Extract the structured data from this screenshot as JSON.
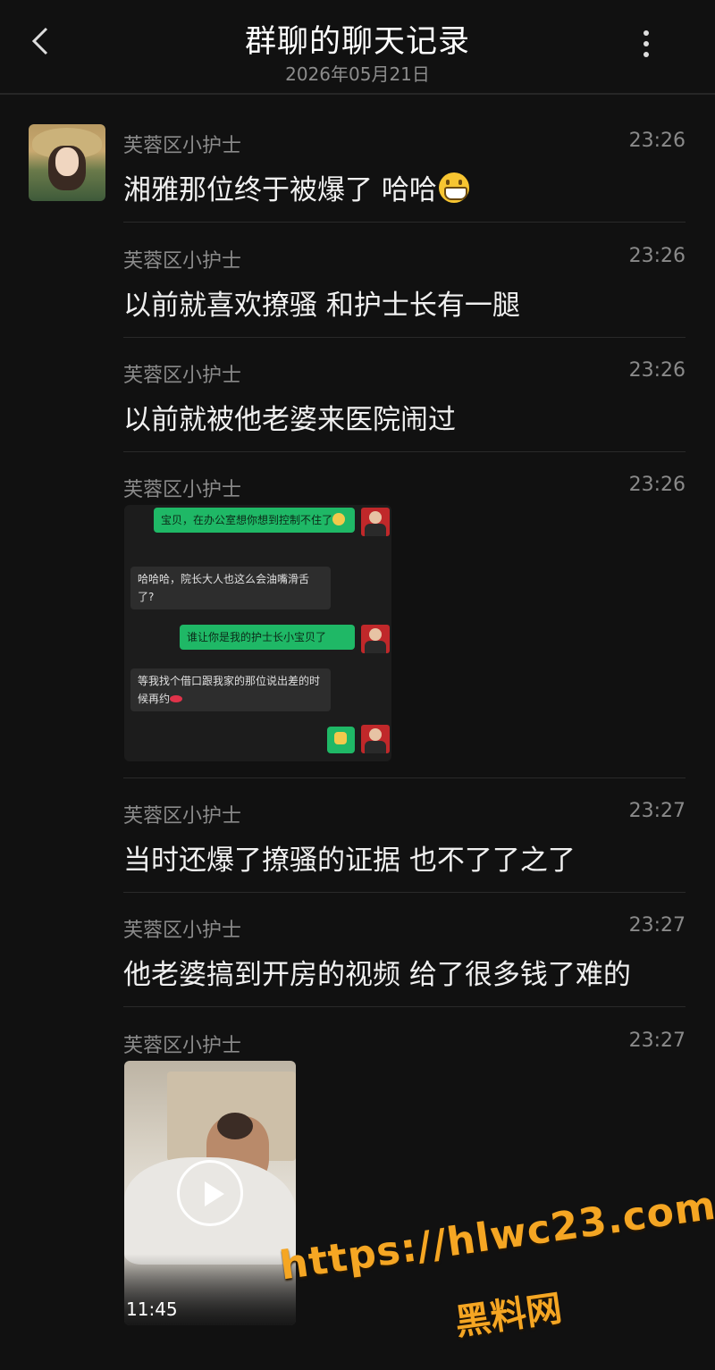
{
  "header": {
    "title": "群聊的聊天记录",
    "date": "2026年05月21日"
  },
  "messages": [
    {
      "sender": "芙蓉区小护士",
      "time": "23:26",
      "text": "湘雅那位终于被爆了 哈哈",
      "emoji": "grinning-face"
    },
    {
      "sender": "芙蓉区小护士",
      "time": "23:26",
      "text": "以前就喜欢撩骚 和护士长有一腿"
    },
    {
      "sender": "芙蓉区小护士",
      "time": "23:26",
      "text": "以前就被他老婆来医院闹过"
    },
    {
      "sender": "芙蓉区小护士",
      "time": "23:26",
      "type": "image"
    },
    {
      "sender": "芙蓉区小护士",
      "time": "23:27",
      "text": "当时还爆了撩骚的证据 也不了了之了"
    },
    {
      "sender": "芙蓉区小护士",
      "time": "23:27",
      "text": "他老婆搞到开房的视频 给了很多钱了难的"
    },
    {
      "sender": "芙蓉区小护士",
      "time": "23:27",
      "type": "video",
      "duration": "11:45"
    }
  ],
  "screenshot_chat": {
    "lines": [
      {
        "side": "right",
        "text": "宝贝，在办公室想你想到控制不住了"
      },
      {
        "side": "left",
        "text": "哈哈哈，院长大人也这么会油嘴滑舌了?"
      },
      {
        "side": "right",
        "text": "谁让你是我的护士长小宝贝了"
      },
      {
        "side": "left",
        "text": "等我找个借口跟我家的那位说出差的时候再约"
      },
      {
        "side": "right",
        "text": ""
      }
    ]
  },
  "watermark": {
    "url": "https://hlwc23.com",
    "name": "黑料网",
    "color": "#f5a623"
  },
  "colors": {
    "background": "#111111",
    "bubble_green": "#1fb866"
  }
}
